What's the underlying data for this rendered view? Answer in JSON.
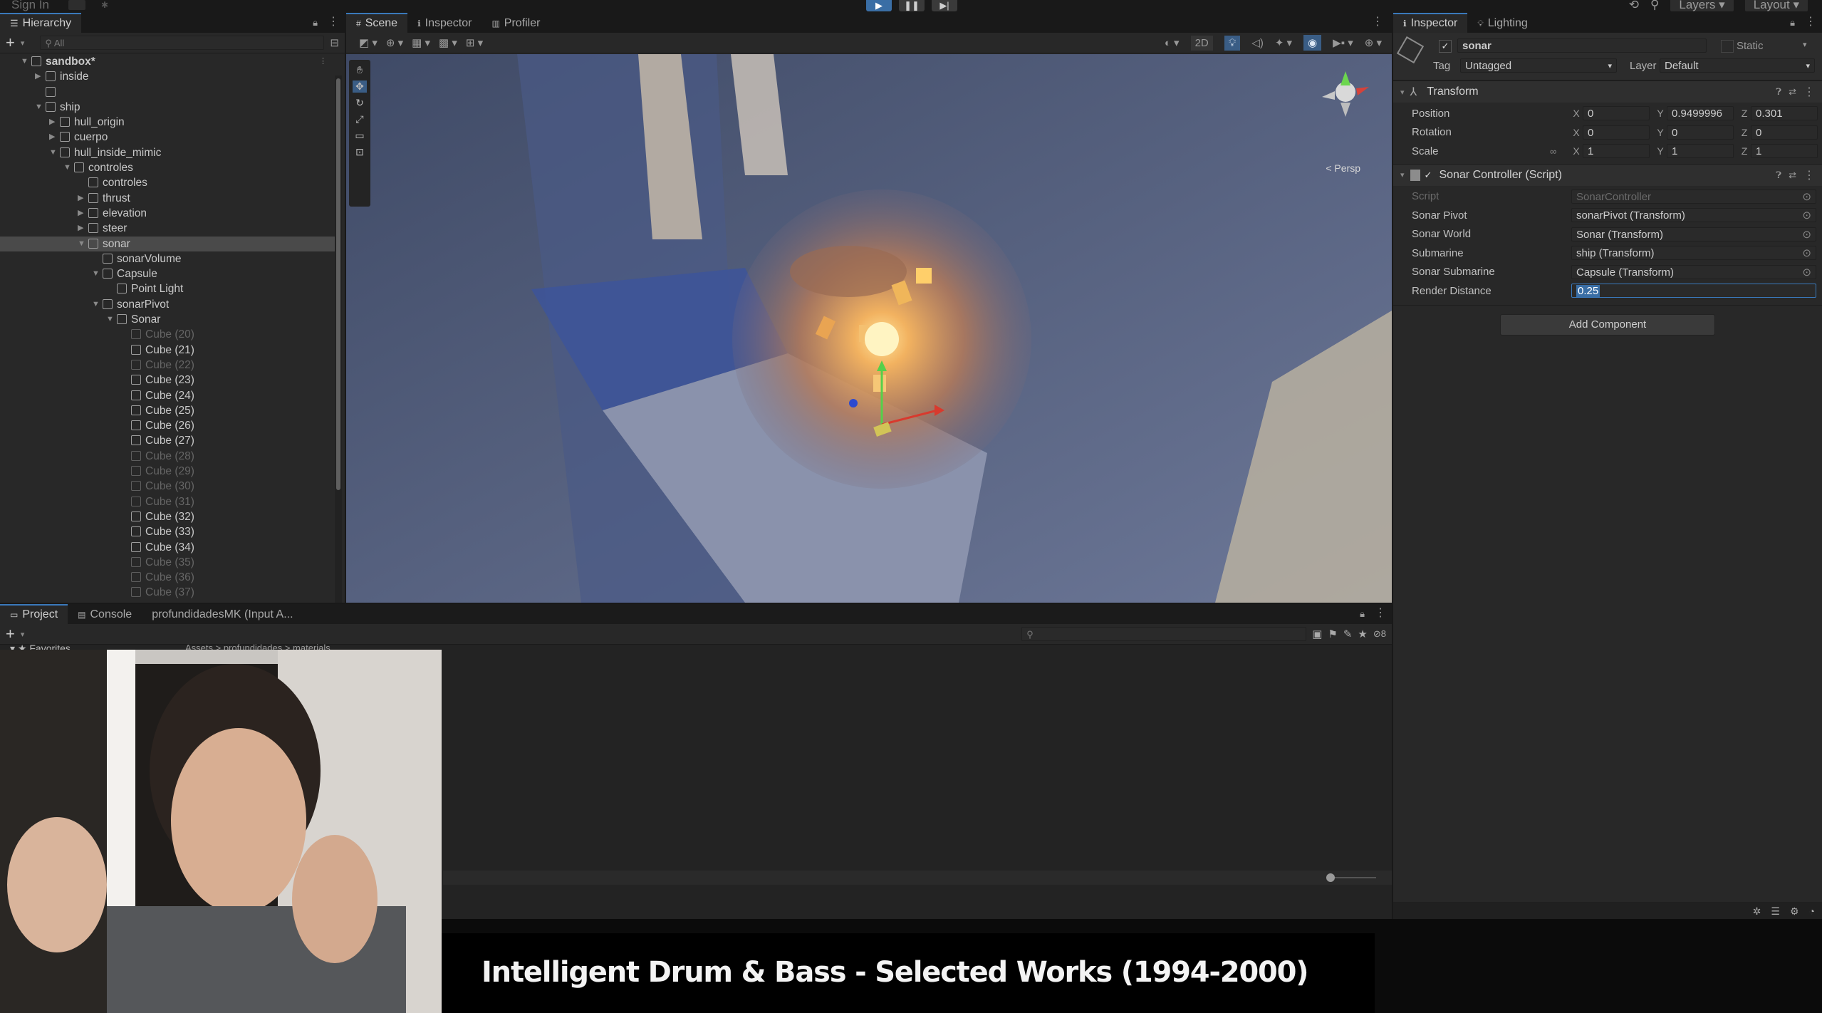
{
  "topbar": {
    "sign_in": "Sign In",
    "layers": "Layers",
    "layout": "Layout"
  },
  "hierarchy": {
    "tab": "Hierarchy",
    "search_placeholder": "All",
    "rows": [
      {
        "label": "sandbox*",
        "depth": 0,
        "arrow": "down",
        "dim": false
      },
      {
        "label": "inside",
        "depth": 1,
        "arrow": "right",
        "dim": false
      },
      {
        "label": "",
        "depth": 1,
        "arrow": "",
        "dim": false
      },
      {
        "label": "ship",
        "depth": 1,
        "arrow": "down",
        "dim": false
      },
      {
        "label": "hull_origin",
        "depth": 2,
        "arrow": "right",
        "dim": false
      },
      {
        "label": "cuerpo",
        "depth": 2,
        "arrow": "right",
        "dim": false
      },
      {
        "label": "hull_inside_mimic",
        "depth": 2,
        "arrow": "down",
        "dim": false
      },
      {
        "label": "controles",
        "depth": 3,
        "arrow": "down",
        "dim": false
      },
      {
        "label": "controles",
        "depth": 4,
        "arrow": "",
        "dim": false
      },
      {
        "label": "thrust",
        "depth": 4,
        "arrow": "right",
        "dim": false
      },
      {
        "label": "elevation",
        "depth": 4,
        "arrow": "right",
        "dim": false
      },
      {
        "label": "steer",
        "depth": 4,
        "arrow": "right",
        "dim": false
      },
      {
        "label": "sonar",
        "depth": 4,
        "arrow": "down",
        "dim": false,
        "selected": true
      },
      {
        "label": "sonarVolume",
        "depth": 5,
        "arrow": "",
        "dim": false
      },
      {
        "label": "Capsule",
        "depth": 5,
        "arrow": "down",
        "dim": false
      },
      {
        "label": "Point Light",
        "depth": 6,
        "arrow": "",
        "dim": false
      },
      {
        "label": "sonarPivot",
        "depth": 5,
        "arrow": "down",
        "dim": false
      },
      {
        "label": "Sonar",
        "depth": 6,
        "arrow": "down",
        "dim": false
      },
      {
        "label": "Cube (20)",
        "depth": 7,
        "arrow": "",
        "dim": true
      },
      {
        "label": "Cube (21)",
        "depth": 7,
        "arrow": "",
        "dim": false
      },
      {
        "label": "Cube (22)",
        "depth": 7,
        "arrow": "",
        "dim": true
      },
      {
        "label": "Cube (23)",
        "depth": 7,
        "arrow": "",
        "dim": false
      },
      {
        "label": "Cube (24)",
        "depth": 7,
        "arrow": "",
        "dim": false
      },
      {
        "label": "Cube (25)",
        "depth": 7,
        "arrow": "",
        "dim": false
      },
      {
        "label": "Cube (26)",
        "depth": 7,
        "arrow": "",
        "dim": false
      },
      {
        "label": "Cube (27)",
        "depth": 7,
        "arrow": "",
        "dim": false
      },
      {
        "label": "Cube (28)",
        "depth": 7,
        "arrow": "",
        "dim": true
      },
      {
        "label": "Cube (29)",
        "depth": 7,
        "arrow": "",
        "dim": true
      },
      {
        "label": "Cube (30)",
        "depth": 7,
        "arrow": "",
        "dim": true
      },
      {
        "label": "Cube (31)",
        "depth": 7,
        "arrow": "",
        "dim": true
      },
      {
        "label": "Cube (32)",
        "depth": 7,
        "arrow": "",
        "dim": false
      },
      {
        "label": "Cube (33)",
        "depth": 7,
        "arrow": "",
        "dim": false
      },
      {
        "label": "Cube (34)",
        "depth": 7,
        "arrow": "",
        "dim": false
      },
      {
        "label": "Cube (35)",
        "depth": 7,
        "arrow": "",
        "dim": true
      },
      {
        "label": "Cube (36)",
        "depth": 7,
        "arrow": "",
        "dim": true
      },
      {
        "label": "Cube (37)",
        "depth": 7,
        "arrow": "",
        "dim": true
      }
    ]
  },
  "scene": {
    "tabs": [
      "Scene",
      "Inspector",
      "Profiler"
    ],
    "toggle_2d": "2D",
    "persp": "Persp"
  },
  "inspector": {
    "tabs": [
      "Inspector",
      "Lighting"
    ],
    "object_name": "sonar",
    "static_label": "Static",
    "tag_label": "Tag",
    "tag_value": "Untagged",
    "layer_label": "Layer",
    "layer_value": "Default",
    "transform": {
      "title": "Transform",
      "position_label": "Position",
      "rotation_label": "Rotation",
      "scale_label": "Scale",
      "position": {
        "x": "0",
        "y": "0.9499996",
        "z": "0.301"
      },
      "rotation": {
        "x": "0",
        "y": "0",
        "z": "0"
      },
      "scale": {
        "x": "1",
        "y": "1",
        "z": "1"
      }
    },
    "script": {
      "title": "Sonar Controller (Script)",
      "fields": [
        {
          "label": "Script",
          "value": "SonarController",
          "dim": true
        },
        {
          "label": "Sonar Pivot",
          "value": "sonarPivot (Transform)"
        },
        {
          "label": "Sonar World",
          "value": "Sonar (Transform)"
        },
        {
          "label": "Submarine",
          "value": "ship (Transform)"
        },
        {
          "label": "Sonar Submarine",
          "value": "Capsule (Transform)"
        }
      ],
      "render_distance_label": "Render Distance",
      "render_distance_value": "0.25"
    },
    "add_component": "Add Component"
  },
  "project": {
    "tabs": [
      "Project",
      "Console",
      "profundidadesMK (Input A..."
    ],
    "favorites": "Favorites",
    "breadcrumb": "Assets > profundidades > materials"
  },
  "overlay": {
    "caption": "Intelligent Drum & Bass - Selected Works (1994-2000)"
  }
}
